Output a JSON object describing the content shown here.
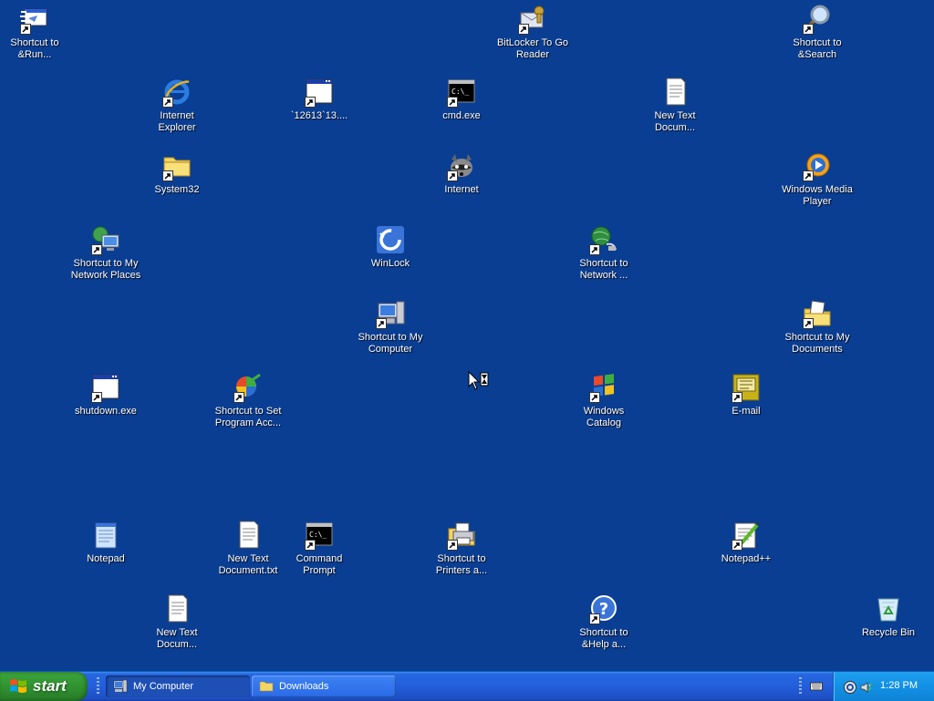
{
  "desktop": {
    "icons": [
      {
        "label": "Shortcut to\n&Run...",
        "icon": "run-icon"
      },
      {
        "label": "BitLocker To Go\nReader",
        "icon": "bitlocker-icon"
      },
      {
        "label": "Shortcut to\n&Search",
        "icon": "search-icon"
      },
      {
        "label": "Internet\nExplorer",
        "icon": "internet-explorer-icon"
      },
      {
        "label": "`12613`13....",
        "icon": "application-window-icon"
      },
      {
        "label": "cmd.exe",
        "icon": "command-prompt-icon"
      },
      {
        "label": "New Text\nDocum...",
        "icon": "text-document-icon"
      },
      {
        "label": "System32",
        "icon": "folder-icon"
      },
      {
        "label": "Internet",
        "icon": "raccoon-icon"
      },
      {
        "label": "Windows Media\nPlayer",
        "icon": "media-player-icon"
      },
      {
        "label": "Shortcut to My\nNetwork Places",
        "icon": "network-places-icon"
      },
      {
        "label": "WinLock",
        "icon": "winlock-icon"
      },
      {
        "label": "Shortcut to\nNetwork ...",
        "icon": "network-globe-icon"
      },
      {
        "label": "Shortcut to My\nComputer",
        "icon": "my-computer-icon"
      },
      {
        "label": "Shortcut to My\nDocuments",
        "icon": "my-documents-icon"
      },
      {
        "label": "shutdown.exe",
        "icon": "application-window-icon"
      },
      {
        "label": "Shortcut to Set\nProgram Acc...",
        "icon": "program-access-icon"
      },
      {
        "label": "Windows\nCatalog",
        "icon": "windows-catalog-icon"
      },
      {
        "label": "E-mail",
        "icon": "email-icon"
      },
      {
        "label": "Notepad",
        "icon": "notepad-icon"
      },
      {
        "label": "New Text\nDocument.txt",
        "icon": "text-document-icon"
      },
      {
        "label": "Command\nPrompt",
        "icon": "command-prompt-icon"
      },
      {
        "label": "Shortcut to\nPrinters a...",
        "icon": "printer-icon"
      },
      {
        "label": "Notepad++",
        "icon": "notepad-plus-icon"
      },
      {
        "label": "New Text\nDocum...",
        "icon": "text-document-icon"
      },
      {
        "label": "Shortcut to\n&Help a...",
        "icon": "help-icon"
      },
      {
        "label": "Recycle Bin",
        "icon": "recycle-bin-icon"
      }
    ]
  },
  "taskbar": {
    "start_label": "start",
    "tasks": [
      {
        "label": "My Computer",
        "icon": "my-computer-icon",
        "active": true
      },
      {
        "label": "Downloads",
        "icon": "folder-icon",
        "active": false
      }
    ],
    "clock": "1:28 PM",
    "tray_icons": [
      "keyboard-icon",
      "network-tray-icon",
      "speaker-tray-icon"
    ]
  },
  "colors": {
    "desktop_background": "#0a3e93",
    "taskbar": "#245edb",
    "start_button": "#3aa23a",
    "tray": "#1290e6"
  }
}
